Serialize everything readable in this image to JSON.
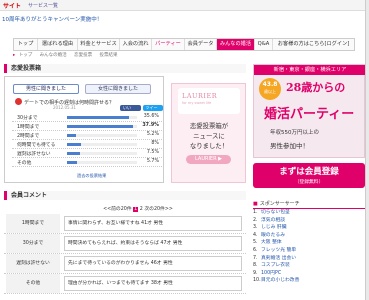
{
  "top_bar": {
    "logo": "サイト",
    "service": "サービス一覧"
  },
  "campaign": {
    "prefix": "10周年",
    "text": "10周年ありがとうキャンペーン実施中！"
  },
  "nav": [
    "トップ",
    "選ばれる理由",
    "料金とサービス",
    "入会の流れ",
    "パーティー",
    "会員データ",
    "みんなの婚活",
    "Q&A",
    "お客様の方はこちら[ログイン]"
  ],
  "breadcrumb": [
    "トップ",
    "みんなの婚活",
    "恋愛投票",
    "投票結果"
  ],
  "vote": {
    "heading": "恋愛投票箱",
    "tab_male": "男性に聞きました",
    "tab_female": "女性に聞きました",
    "question": "デートでの相手の遅刻は何時間許せる？",
    "meta": "2012.05.31",
    "tweet": "ツイート",
    "like": "いいね！",
    "rows": [
      {
        "label": "30分まで",
        "pct": "35.6%",
        "value": 35.6
      },
      {
        "label": "1時間まで",
        "pct": "37.9%",
        "value": 37.9
      },
      {
        "label": "2時間まで",
        "pct": "5.2%",
        "value": 5.2
      },
      {
        "label": "何時間でも待てる",
        "pct": "8%",
        "value": 8
      },
      {
        "label": "遅刻は許せない",
        "pct": "7.5%",
        "value": 7.5
      },
      {
        "label": "その他",
        "pct": "5.7%",
        "value": 5.7
      }
    ],
    "past_link": "過去の投票結果"
  },
  "promo": {
    "brand": "LAURIER",
    "brand_sub": "for my sweet life",
    "text_lines": [
      "恋愛投票箱が",
      "ニュースに",
      "なりました！"
    ],
    "button": "LAURIER ▶"
  },
  "comments": {
    "heading": "会員コメント",
    "pager": {
      "prev": "<<前の20件",
      "p1": "1",
      "p2": "2",
      "next": "次の20件>>"
    },
    "items": [
      {
        "label": "1時間まで",
        "text": "事情に関わらず、お互い様ですね 41才 男性"
      },
      {
        "label": "30分まで",
        "text": "時間決めてもらえれば、約束はそうならば 47才 男性"
      },
      {
        "label": "遅刻は許せない",
        "text": "先にまで待っているのがわかりません 46才 男性"
      },
      {
        "label": "その他",
        "text": "理由が分かれば、いつまでも待てます 38才 男性"
      }
    ]
  },
  "ad": {
    "area": "新宿・東京・銀座・横浜エリア",
    "badge_top": "43.8",
    "badge_bottom": "歳以上",
    "title1": "28歳からの",
    "title2": "婚活パーティー",
    "line1": "年収550万円以上の",
    "line2": "男性参加中！"
  },
  "register": {
    "title": "まずは会員登録",
    "sub": "（登録無料）"
  },
  "sponsored": {
    "heading": "スポンサーサーチ",
    "items": [
      {
        "num": "1.",
        "label": "切らない包茎"
      },
      {
        "num": "2.",
        "label": "浮気の相談"
      },
      {
        "num": "3.",
        "label": "しじみ 肝臓"
      },
      {
        "num": "4.",
        "label": "眼のたるみ"
      },
      {
        "num": "5.",
        "label": "大阪 整体"
      },
      {
        "num": "6.",
        "label": "フレッツ光 簡単"
      },
      {
        "num": "7.",
        "label": "真剣婚活 出会い"
      },
      {
        "num": "8.",
        "label": "コスプレ衣装"
      },
      {
        "num": "9.",
        "label": "100円PC"
      },
      {
        "num": "10.",
        "label": "目元の小じわ改善"
      }
    ]
  }
}
